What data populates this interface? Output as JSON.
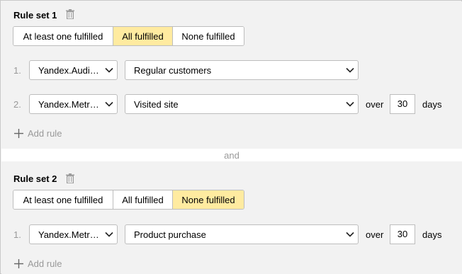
{
  "rule_sets": [
    {
      "title": "Rule set 1",
      "segments": [
        "At least one fulfilled",
        "All fulfilled",
        "None fulfilled"
      ],
      "active_segment": "All fulfilled",
      "rules": [
        {
          "num": "1.",
          "source": "Yandex.Audi…",
          "condition": "Regular customers"
        },
        {
          "num": "2.",
          "source": "Yandex.Metr…",
          "condition": "Visited site",
          "over_label": "over",
          "days_value": "30",
          "days_label": "days"
        }
      ],
      "add_rule_label": "Add rule"
    },
    {
      "title": "Rule set 2",
      "segments": [
        "At least one fulfilled",
        "All fulfilled",
        "None fulfilled"
      ],
      "active_segment": "None fulfilled",
      "rules": [
        {
          "num": "1.",
          "source": "Yandex.Metr…",
          "condition": "Product purchase",
          "over_label": "over",
          "days_value": "30",
          "days_label": "days"
        }
      ],
      "add_rule_label": "Add rule"
    }
  ],
  "separator_label": "and",
  "colors": {
    "active_segment": "#ffeba0",
    "muted_text": "#999999",
    "panel_bg": "#f2f2f2",
    "border": "#bdbdbd"
  },
  "icons": {
    "delete": "trash-icon",
    "dropdown": "chevron-down-icon",
    "add": "plus-icon"
  }
}
